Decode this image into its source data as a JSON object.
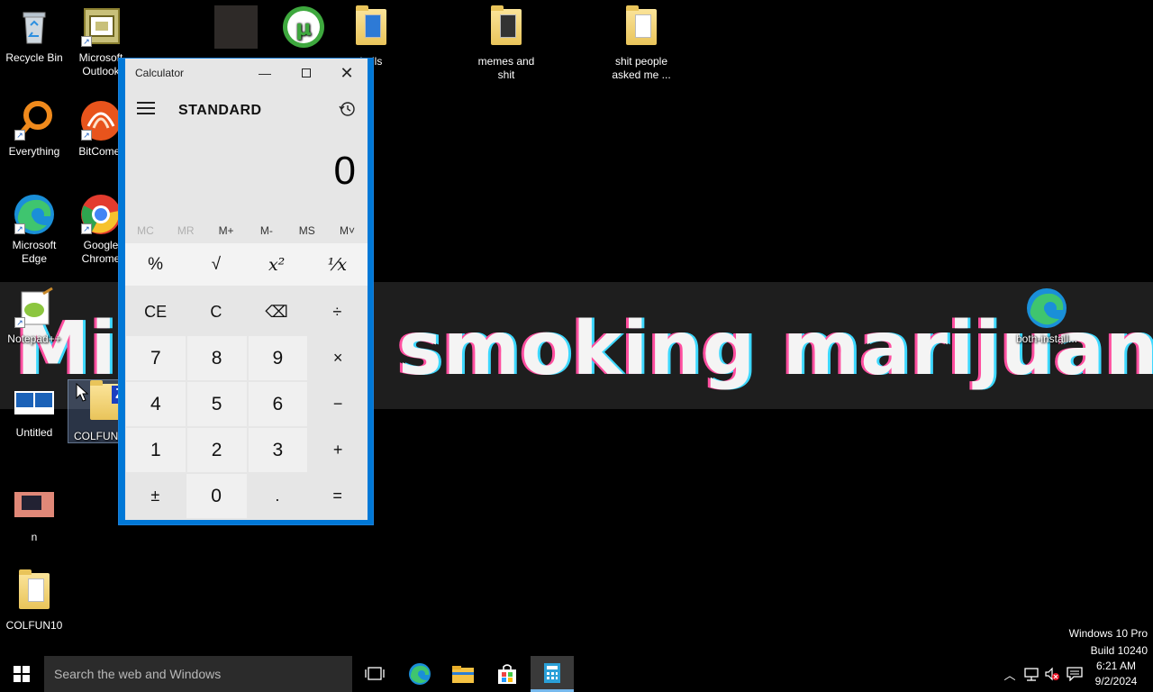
{
  "desktop": {
    "icons": [
      {
        "label": "Recycle Bin"
      },
      {
        "label": "Microsoft Outlook"
      },
      {
        "label": "Everything"
      },
      {
        "label": "BitComet"
      },
      {
        "label": "Microsoft Edge"
      },
      {
        "label": "Google Chrome"
      },
      {
        "label": "Notepad++"
      },
      {
        "label": "Untitled"
      },
      {
        "label": "COLFUN"
      },
      {
        "label": "n"
      },
      {
        "label": "COLFUN10"
      },
      {
        "label": "balls"
      },
      {
        "label": "memes and shit"
      },
      {
        "label": "shit people asked me ..."
      },
      {
        "label": "both-install..."
      }
    ]
  },
  "wallpaper": {
    "text_left": "Mi",
    "text_right": "smoking marijuana"
  },
  "calculator": {
    "window_title": "Calculator",
    "mode": "STANDARD",
    "display": "0",
    "memory": [
      "MC",
      "MR",
      "M+",
      "M-",
      "MS",
      "M˅"
    ],
    "memory_disabled": [
      "MC",
      "MR"
    ],
    "rows": [
      [
        "%",
        "√",
        "x²",
        "¹⁄x"
      ],
      [
        "CE",
        "C",
        "⌫",
        "÷"
      ],
      [
        "7",
        "8",
        "9",
        "×"
      ],
      [
        "4",
        "5",
        "6",
        "−"
      ],
      [
        "1",
        "2",
        "3",
        "+"
      ],
      [
        "±",
        "0",
        ".",
        "="
      ]
    ]
  },
  "watermark": {
    "line1": "Windows 10 Pro",
    "line2": "Build 10240"
  },
  "taskbar": {
    "search_placeholder": "Search the web and Windows",
    "apps": [
      "task-view",
      "edge",
      "file-explorer",
      "store",
      "calculator"
    ],
    "active_app": "calculator",
    "time": "6:21 AM",
    "date": "9/2/2024"
  },
  "colors": {
    "accent": "#0078d7",
    "calc_bg": "#e6e6e6",
    "number_key": "#f0f0f0"
  }
}
